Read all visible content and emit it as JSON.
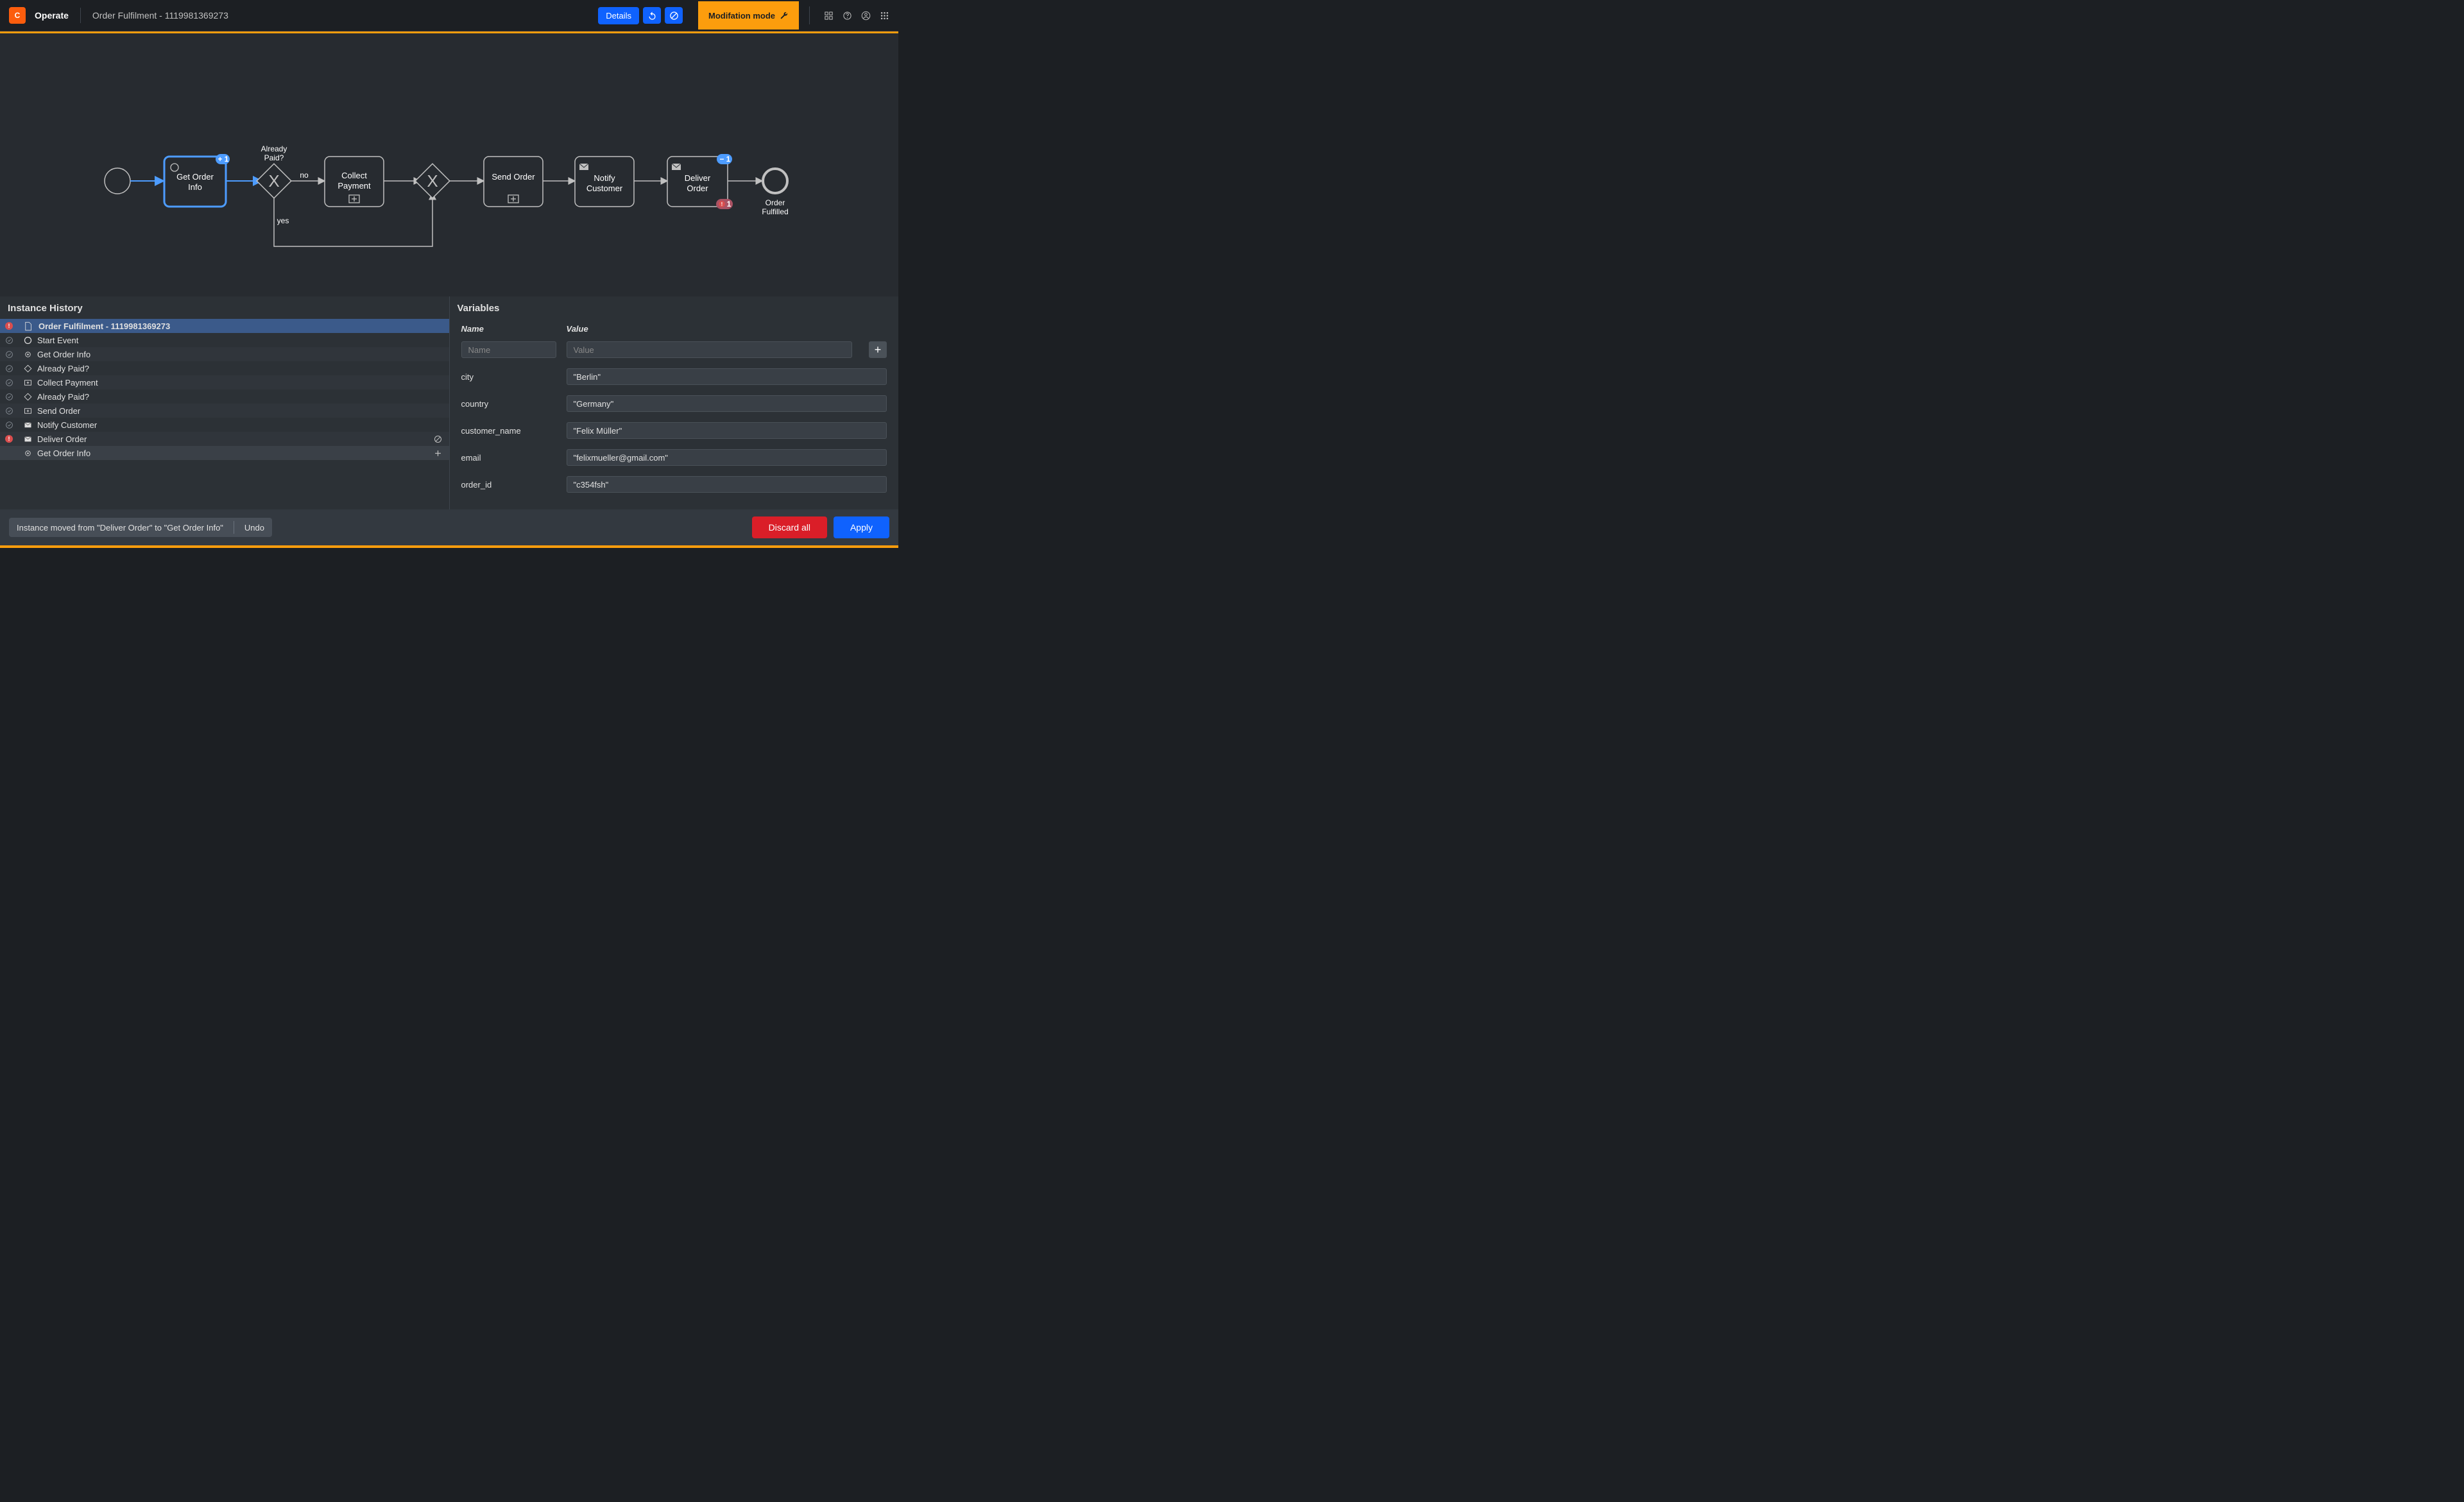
{
  "header": {
    "app_name": "Operate",
    "breadcrumb": "Order Fulfilment - 1119981369273",
    "details_label": "Details",
    "mode_label": "Modifation mode"
  },
  "diagram": {
    "nodes": {
      "get_order_info": {
        "line1": "Get Order",
        "line2": "Info",
        "badge": "1",
        "badge_icon": "+"
      },
      "already_paid": {
        "line1": "Already",
        "line2": "Paid?"
      },
      "collect_payment": {
        "line1": "Collect",
        "line2": "Payment"
      },
      "send_order": {
        "label": "Send Order"
      },
      "notify_customer": {
        "line1": "Notify",
        "line2": "Customer"
      },
      "deliver_order": {
        "line1": "Deliver",
        "line2": "Order",
        "badge": "1",
        "badge_icon": "−",
        "error_badge": "1"
      },
      "end": {
        "line1": "Order",
        "line2": "Fulfilled"
      }
    },
    "edge_labels": {
      "no": "no",
      "yes": "yes"
    }
  },
  "history": {
    "title": "Instance History",
    "rows": [
      {
        "status": "error",
        "type": "document",
        "name": "Order Fulfilment - 1119981369273",
        "top": true,
        "action": ""
      },
      {
        "status": "done",
        "type": "circle",
        "name": "Start Event"
      },
      {
        "status": "done",
        "type": "gear",
        "name": "Get Order Info"
      },
      {
        "status": "done",
        "type": "gateway",
        "name": "Already Paid?"
      },
      {
        "status": "done",
        "type": "subproc",
        "name": "Collect Payment"
      },
      {
        "status": "done",
        "type": "gateway",
        "name": "Already Paid?"
      },
      {
        "status": "done",
        "type": "subproc",
        "name": "Send Order"
      },
      {
        "status": "done",
        "type": "envelope",
        "name": "Notify Customer"
      },
      {
        "status": "error",
        "type": "envelope",
        "name": "Deliver Order",
        "action": "cancel"
      },
      {
        "status": "",
        "type": "gear",
        "name": "Get Order Info",
        "action": "add",
        "last": true
      }
    ]
  },
  "variables": {
    "title": "Variables",
    "name_header": "Name",
    "value_header": "Value",
    "name_placeholder": "Name",
    "value_placeholder": "Value",
    "rows": [
      {
        "name": "city",
        "value": "\"Berlin\""
      },
      {
        "name": "country",
        "value": "\"Germany\""
      },
      {
        "name": "customer_name",
        "value": "\"Felix Müller\""
      },
      {
        "name": "email",
        "value": "\"felixmueller@gmail.com\""
      },
      {
        "name": "order_id",
        "value": "\"c354fsh\""
      }
    ]
  },
  "footer": {
    "toast_message": "Instance moved from \"Deliver Order\" to \"Get Order Info\"",
    "undo_label": "Undo",
    "discard_label": "Discard all",
    "apply_label": "Apply"
  }
}
